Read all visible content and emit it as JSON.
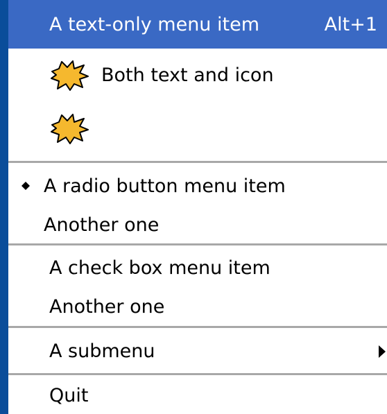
{
  "menu": {
    "items": [
      {
        "label": "A text-only menu item",
        "shortcut": "Alt+1",
        "state": "highlighted"
      },
      {
        "label": "Both text and icon",
        "icon": "star-burst-icon"
      },
      {
        "icon": "star-burst-icon"
      },
      {
        "label": "A radio button menu item",
        "type": "radio",
        "selected": true
      },
      {
        "label": "Another one",
        "type": "radio",
        "selected": false
      },
      {
        "label": "A check box menu item",
        "type": "checkbox"
      },
      {
        "label": "Another one",
        "type": "checkbox"
      },
      {
        "label": "A submenu",
        "icon": "submenu-arrow-icon"
      },
      {
        "label": "Quit"
      }
    ],
    "colors": {
      "highlight": "#3a69c4",
      "icon_fill": "#f5b82e",
      "window_frame": "#0a4d9a",
      "separator": "#a8a8a8"
    }
  }
}
